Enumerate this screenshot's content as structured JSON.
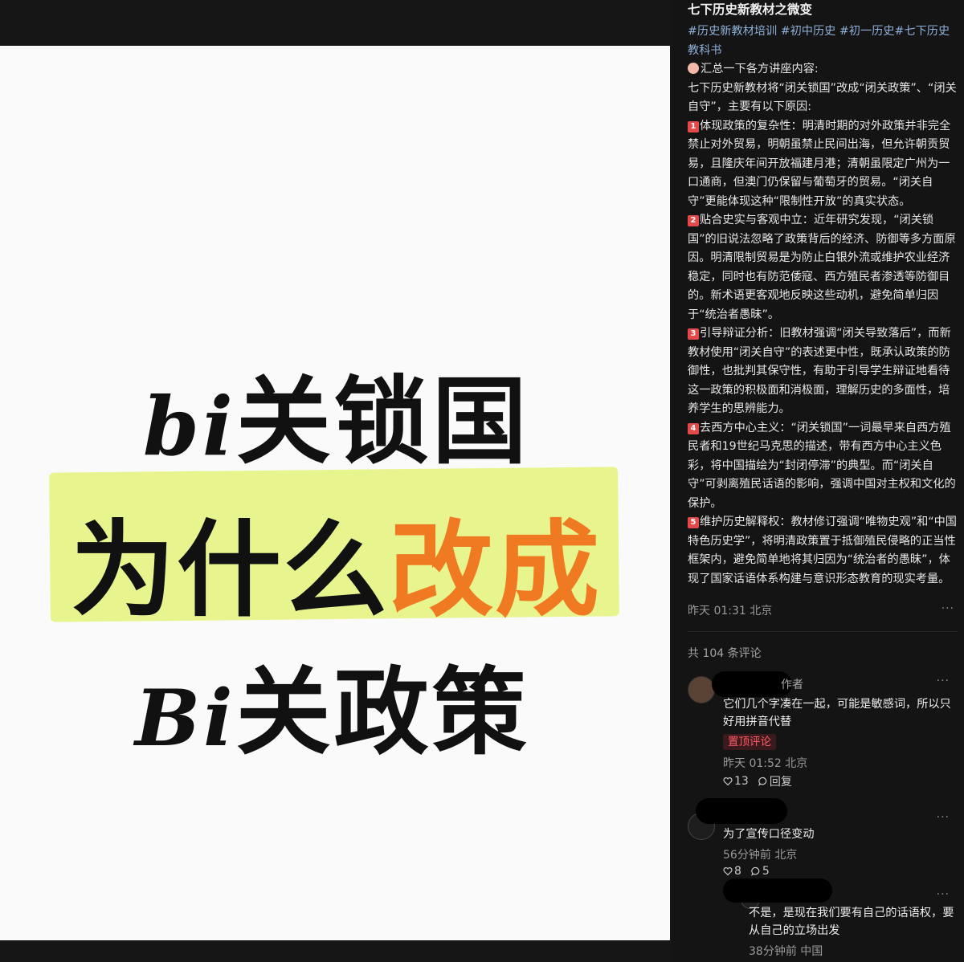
{
  "image": {
    "line1_latin": "bi",
    "line1_cn": "关锁国",
    "line2_black": "为什么",
    "line2_orange": "改成",
    "line3_latin": "Bi",
    "line3_cn": "关政策"
  },
  "post": {
    "title": "七下历史新教材之微变",
    "tags": [
      "#历史新教材培训",
      "#初中历史",
      "#初一历史",
      "#七下历史教科书"
    ],
    "intro": "汇总一下各方讲座内容:",
    "lead": "七下历史新教材将“闭关锁国”改成“闭关政策”、“闭关自守”，主要有以下原因:",
    "points": [
      {
        "num": "1",
        "text": "体现政策的复杂性：明清时期的对外政策并非完全禁止对外贸易，明朝虽禁止民间出海，但允许朝贡贸易，且隆庆年间开放福建月港；清朝虽限定广州为一口通商，但澳门仍保留与葡萄牙的贸易。“闭关自守”更能体现这种“限制性开放”的真实状态。"
      },
      {
        "num": "2",
        "text": "贴合史实与客观中立：近年研究发现，“闭关锁国”的旧说法忽略了政策背后的经济、防御等多方面原因。明清限制贸易是为防止白银外流或维护农业经济稳定，同时也有防范倭寇、西方殖民者渗透等防御目的。新术语更客观地反映这些动机，避免简单归因于“统治者愚昧”。"
      },
      {
        "num": "3",
        "text": "引导辩证分析：旧教材强调“闭关导致落后”，而新教材使用“闭关自守”的表述更中性，既承认政策的防御性，也批判其保守性，有助于引导学生辩证地看待这一政策的积极面和消极面，理解历史的多面性，培养学生的思辨能力。"
      },
      {
        "num": "4",
        "text": "去西方中心主义：“闭关锁国”一词最早来自西方殖民者和19世纪马克思的描述，带有西方中心主义色彩，将中国描绘为“封闭停滞”的典型。而“闭关自守”可剥离殖民话语的影响，强调中国对主权和文化的保护。"
      },
      {
        "num": "5",
        "text": "维护历史解释权：教材修订强调“唯物史观”和“中国特色历史学”，将明清政策置于抵御殖民侵略的正当性框架内，避免简单地将其归因为“统治者的愚昧”，体现了国家话语体系构建与意识形态教育的现实考量。"
      }
    ],
    "time": "昨天 01:31 北京",
    "more": "···"
  },
  "comments": {
    "count_label": "共 104 条评论",
    "items": [
      {
        "author_tag": "作者",
        "text": "它们几个字凑在一起，可能是敏感词，所以只好用拼音代替",
        "pinned": "置顶评论",
        "time": "昨天 01:52 北京",
        "likes": "13",
        "reply_label": "回复",
        "more": "···"
      },
      {
        "text": "为了宣传口径变动",
        "time": "56分钟前 北京",
        "likes": "8",
        "replies": "5",
        "more": "···"
      },
      {
        "text": "不是，是现在我们要有自己的话语权，要从自己的立场出发",
        "time": "38分钟前 中国",
        "more": "···"
      }
    ]
  },
  "colors": {
    "highlight": "#e8f58e",
    "orange": "#ef7a22",
    "tag": "#8fb0d9",
    "pinned": "#ff5a64"
  }
}
